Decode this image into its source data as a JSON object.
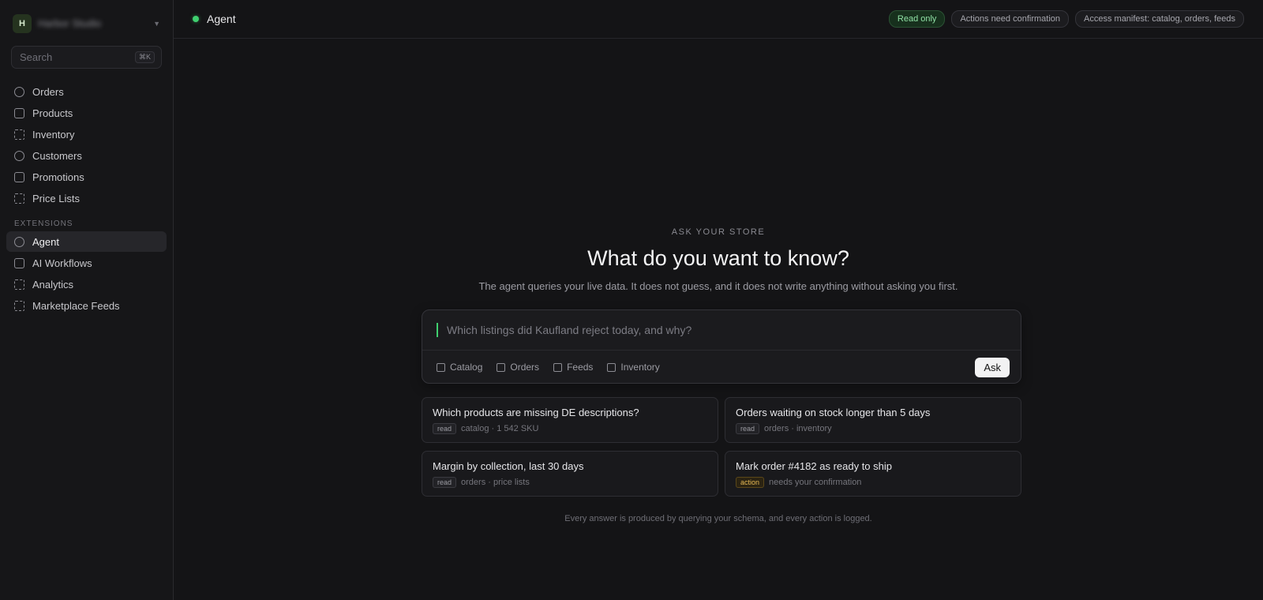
{
  "workspace": {
    "initial": "H",
    "name": "Harbor Studio"
  },
  "search": {
    "placeholder": "Search",
    "shortcut": "⌘K"
  },
  "nav": {
    "items": [
      {
        "label": "Orders",
        "icon": "circle-icon"
      },
      {
        "label": "Products",
        "icon": "square-icon"
      },
      {
        "label": "Inventory",
        "icon": "dashed-square-icon"
      },
      {
        "label": "Customers",
        "icon": "circle-icon"
      },
      {
        "label": "Promotions",
        "icon": "square-icon"
      },
      {
        "label": "Price Lists",
        "icon": "dashed-square-icon"
      }
    ],
    "extensions_label": "EXTENSIONS",
    "extensions": [
      {
        "label": "Agent",
        "icon": "circle-icon",
        "active": true
      },
      {
        "label": "AI Workflows",
        "icon": "square-icon"
      },
      {
        "label": "Analytics",
        "icon": "dashed-square-icon"
      },
      {
        "label": "Marketplace Feeds",
        "icon": "dashed-square-icon"
      }
    ]
  },
  "topbar": {
    "title": "Agent",
    "status_color": "#3fcf6f",
    "pills": [
      "Read only",
      "Actions need confirmation",
      "Access manifest: catalog, orders, feeds"
    ]
  },
  "hero": {
    "eyebrow": "ASK YOUR STORE",
    "headline": "What do you want to know?",
    "subline": "The agent queries your live data. It does not guess, and it does not write anything without asking you first."
  },
  "composer": {
    "placeholder": "Which listings did Kaufland reject today, and why?",
    "scopes": [
      "Catalog",
      "Orders",
      "Feeds",
      "Inventory"
    ],
    "ask_label": "Ask"
  },
  "suggestions": [
    {
      "title": "Which products are missing DE descriptions?",
      "tag": "read",
      "meta": "catalog · 1 542 SKU"
    },
    {
      "title": "Orders waiting on stock longer than 5 days",
      "tag": "read",
      "meta": "orders · inventory"
    },
    {
      "title": "Margin by collection, last 30 days",
      "tag": "read",
      "meta": "orders · price lists"
    },
    {
      "title": "Mark order #4182 as ready to ship",
      "tag": "action",
      "meta": "needs your confirmation"
    }
  ],
  "footnote": "Every answer is produced by querying your schema, and every action is logged."
}
